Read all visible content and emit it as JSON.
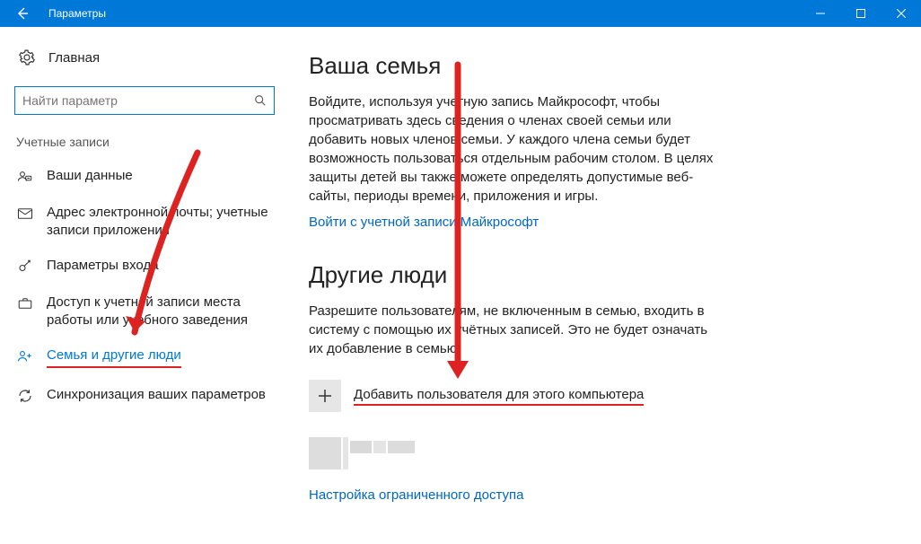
{
  "titlebar": {
    "title": "Параметры"
  },
  "sidebar": {
    "home": "Главная",
    "search_placeholder": "Найти параметр",
    "section_label": "Учетные записи",
    "items": [
      {
        "label": "Ваши данные"
      },
      {
        "label": "Адрес электронной почты; учетные записи приложения"
      },
      {
        "label": "Параметры входа"
      },
      {
        "label": "Доступ к учетной записи места работы или учебного заведения"
      },
      {
        "label": "Семья и другие люди"
      },
      {
        "label": "Синхронизация ваших параметров"
      }
    ]
  },
  "main": {
    "family": {
      "heading": "Ваша семья",
      "body": "Войдите, используя учетную запись Майкрософт, чтобы просматривать здесь сведения о членах своей семьи или добавить новых членов семьи. У каждого члена семьи будет возможность пользоваться отдельным рабочим столом. В целях защиты детей вы также можете определять допустимые веб-сайты, периоды времени, приложения и игры.",
      "signin_link": "Войти с учетной записи Майкрософт"
    },
    "others": {
      "heading": "Другие люди",
      "body": "Разрешите пользователям, не включенным в семью, входить в систему с помощью их учётных записей. Это не будет означать их добавление в семью.",
      "add_label": "Добавить пользователя для этого компьютера",
      "limited_link": "Настройка ограниченного доступа"
    }
  }
}
